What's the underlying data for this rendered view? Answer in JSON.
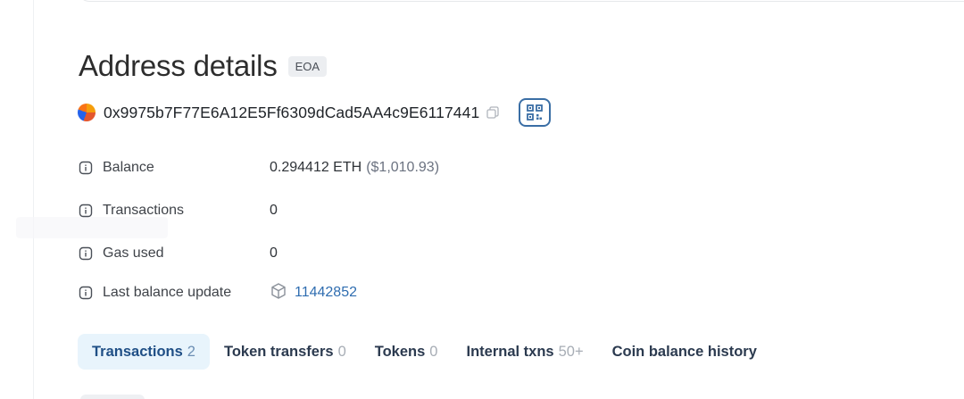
{
  "header": {
    "title": "Address details",
    "badge": "EOA"
  },
  "address": {
    "value": "0x9975b7F77E6A12E5Ff6309dCad5AA4c9E6117441",
    "copy_icon": "copy-icon",
    "qr_icon": "qr-code-icon"
  },
  "details": [
    {
      "label": "Balance",
      "value": "0.294412 ETH",
      "extra": "($1,010.93)"
    },
    {
      "label": "Transactions",
      "value": "0"
    },
    {
      "label": "Gas used",
      "value": "0"
    },
    {
      "label": "Last balance update",
      "value": "11442852",
      "icon": "block-icon"
    }
  ],
  "tabs": [
    {
      "label": "Transactions",
      "count": "2",
      "active": true
    },
    {
      "label": "Token transfers",
      "count": "0"
    },
    {
      "label": "Tokens",
      "count": "0"
    },
    {
      "label": "Internal txns",
      "count": "50+"
    },
    {
      "label": "Coin balance history",
      "count": ""
    }
  ],
  "colors": {
    "accent": "#2f6db0",
    "active_tab_bg": "#e8f4fc",
    "badge_bg": "#eceef1"
  }
}
